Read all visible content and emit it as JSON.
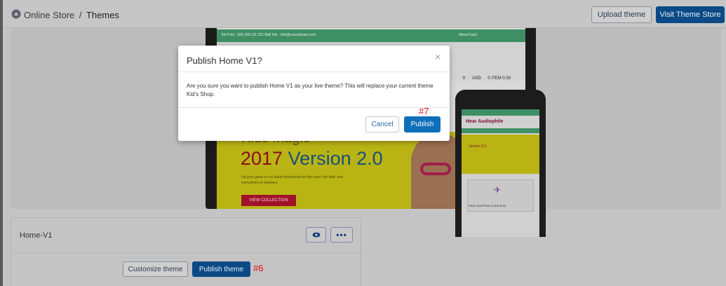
{
  "header": {
    "breadcrumb_parent": "Online Store",
    "breadcrumb_separator": "/",
    "breadcrumb_current": "Themes",
    "upload_label": "Upload theme",
    "visit_label": "Visit Theme Store"
  },
  "preview": {
    "topbar_left": "Toll Free : (00) 000 111 222   Mail Info : info@yourdomain.com",
    "topbar_right": "About   Faq's",
    "currency": "USD",
    "cart": "0 ITEM 0.00",
    "hero_word": "Kids Magic",
    "hero_year": "2017",
    "hero_version": "Version 2.0",
    "hero_sub": "Up your game in our latest innovations for the court, the field, and everywhere in between.",
    "hero_button": "VIEW COLLECTION",
    "phone_logo": "Hear Audiophile",
    "phone_hero": "Version 2.0",
    "phone_shipping": "FREE SHIPPING OVER $150"
  },
  "modal": {
    "title": "Publish Home V1?",
    "close": "×",
    "body": "Are you sure you want to publish Home V1 as your live theme? This will replace your current theme Kid's Shop.",
    "cancel_label": "Cancel",
    "publish_label": "Publish",
    "annotation": "#7"
  },
  "theme_card": {
    "name": "Home-V1",
    "more": "•••",
    "customize_label": "Customize theme",
    "publish_label": "Publish theme",
    "annotation": "#6"
  },
  "colors": {
    "primary": "#0e6fba",
    "annotation": "#e01010"
  }
}
